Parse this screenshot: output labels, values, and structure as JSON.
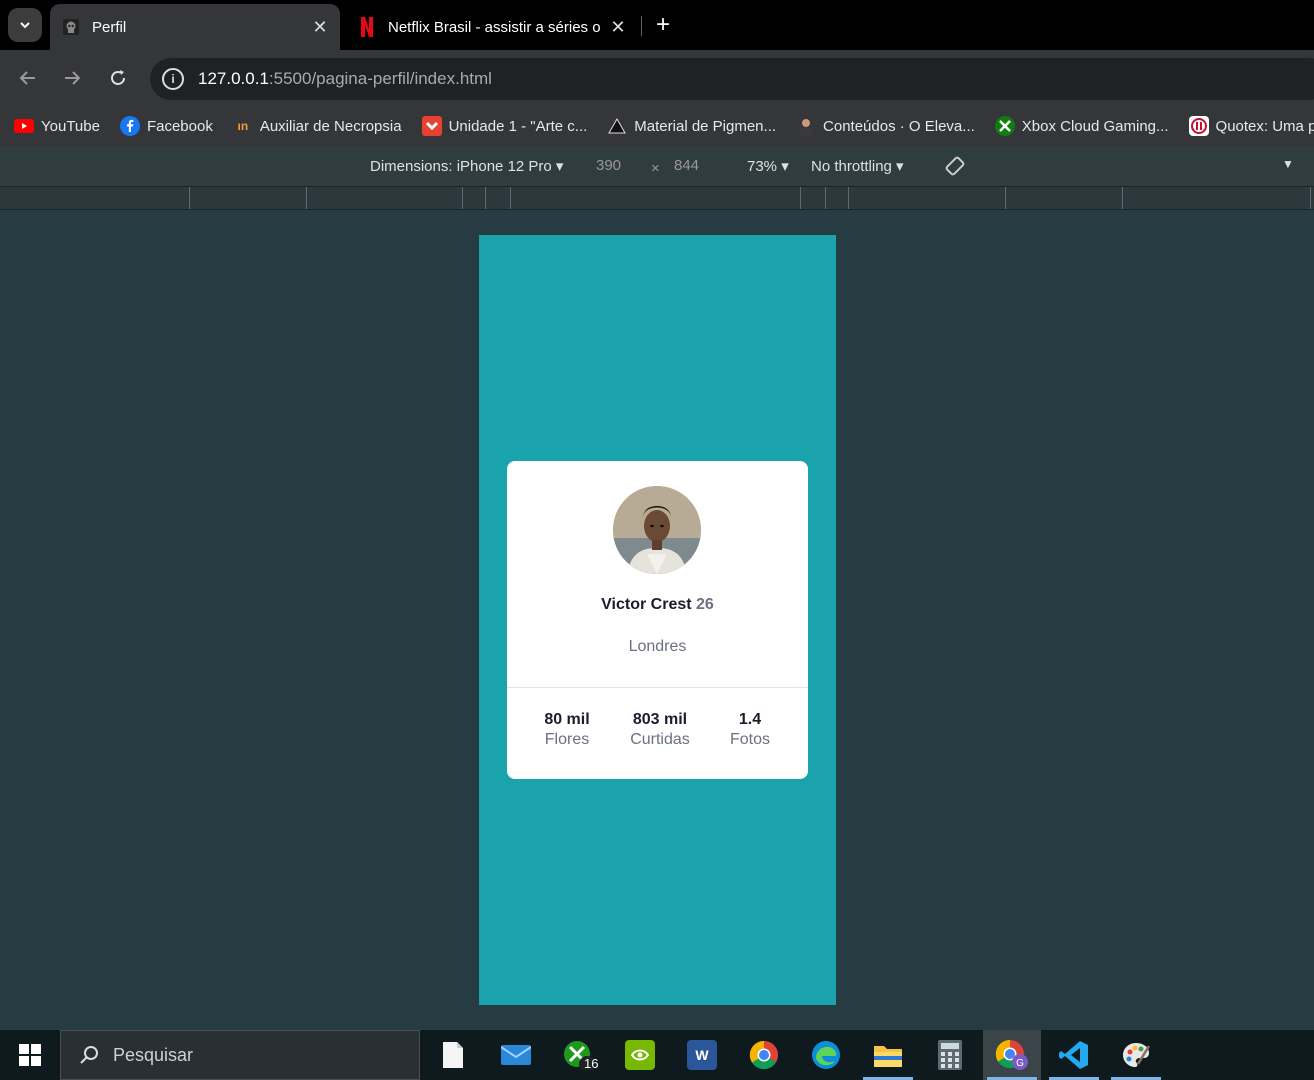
{
  "browser": {
    "tabs": [
      {
        "title": "Perfil",
        "active": true
      },
      {
        "title": "Netflix Brasil - assistir a séries o",
        "active": false
      }
    ],
    "new_tab_symbol": "+",
    "close_symbol": "✕",
    "url": {
      "host": "127.0.0.1",
      "path": ":5500/pagina-perfil/index.html"
    },
    "bookmarks": [
      {
        "label": "YouTube",
        "icon": "youtube-icon",
        "color": "#ff0000"
      },
      {
        "label": "Facebook",
        "icon": "facebook-icon",
        "color": "#1877f2"
      },
      {
        "label": "Auxiliar de Necropsia",
        "icon": "auxiliar-icon",
        "color": "#f29b30"
      },
      {
        "label": "Unidade 1 - \"Arte c...",
        "icon": "unidade-icon",
        "color": "#e8412f"
      },
      {
        "label": "Material de Pigmen...",
        "icon": "pigment-icon",
        "color": "#222222"
      },
      {
        "label": "Conteúdos · O Eleva...",
        "icon": "eleva-icon",
        "color": "#7a5a44"
      },
      {
        "label": "Xbox Cloud Gaming...",
        "icon": "xbox-icon",
        "color": "#107c10"
      },
      {
        "label": "Quotex: Uma p",
        "icon": "quotex-icon",
        "color": "#c8102e"
      }
    ]
  },
  "devtools": {
    "dimensions_label": "Dimensions: iPhone 12 Pro",
    "width": "390",
    "times": "×",
    "height": "844",
    "zoom": "73%",
    "throttling": "No throttling"
  },
  "profile": {
    "name": "Victor Crest",
    "age": "26",
    "city": "Londres",
    "stats": [
      {
        "value": "80 mil",
        "label": "Flores"
      },
      {
        "value": "803 mil",
        "label": "Curtidas"
      },
      {
        "value": "1.4",
        "label": "Fotos"
      }
    ]
  },
  "taskbar": {
    "search_placeholder": "Pesquisar",
    "badge": "16",
    "apps": [
      "file-explorer-blank",
      "mail",
      "xbox",
      "nvidia",
      "word",
      "chrome",
      "edge",
      "file-explorer",
      "calculator",
      "chrome-profile",
      "vscode",
      "paint"
    ]
  },
  "colors": {
    "viewport_bg": "#1aa2ad",
    "card_bg": "#ffffff",
    "page_bg": "#263b42"
  }
}
